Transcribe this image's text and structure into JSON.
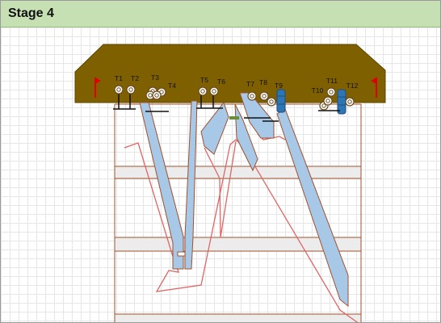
{
  "header": {
    "title": "Stage 4"
  },
  "targets": [
    {
      "label": "T1"
    },
    {
      "label": "T2"
    },
    {
      "label": "T3"
    },
    {
      "label": "T4"
    },
    {
      "label": "T5"
    },
    {
      "label": "T6"
    },
    {
      "label": "T7"
    },
    {
      "label": "T8"
    },
    {
      "label": "T9"
    },
    {
      "label": "T10"
    },
    {
      "label": "T11"
    },
    {
      "label": "T12"
    }
  ],
  "colors": {
    "header": "#c6e0b4",
    "berm": "#7f6000",
    "fault_line": "#e06666",
    "shooting_lane": "#a8c8e8",
    "flag": "#e00000",
    "barrel": "#2e75b6"
  }
}
